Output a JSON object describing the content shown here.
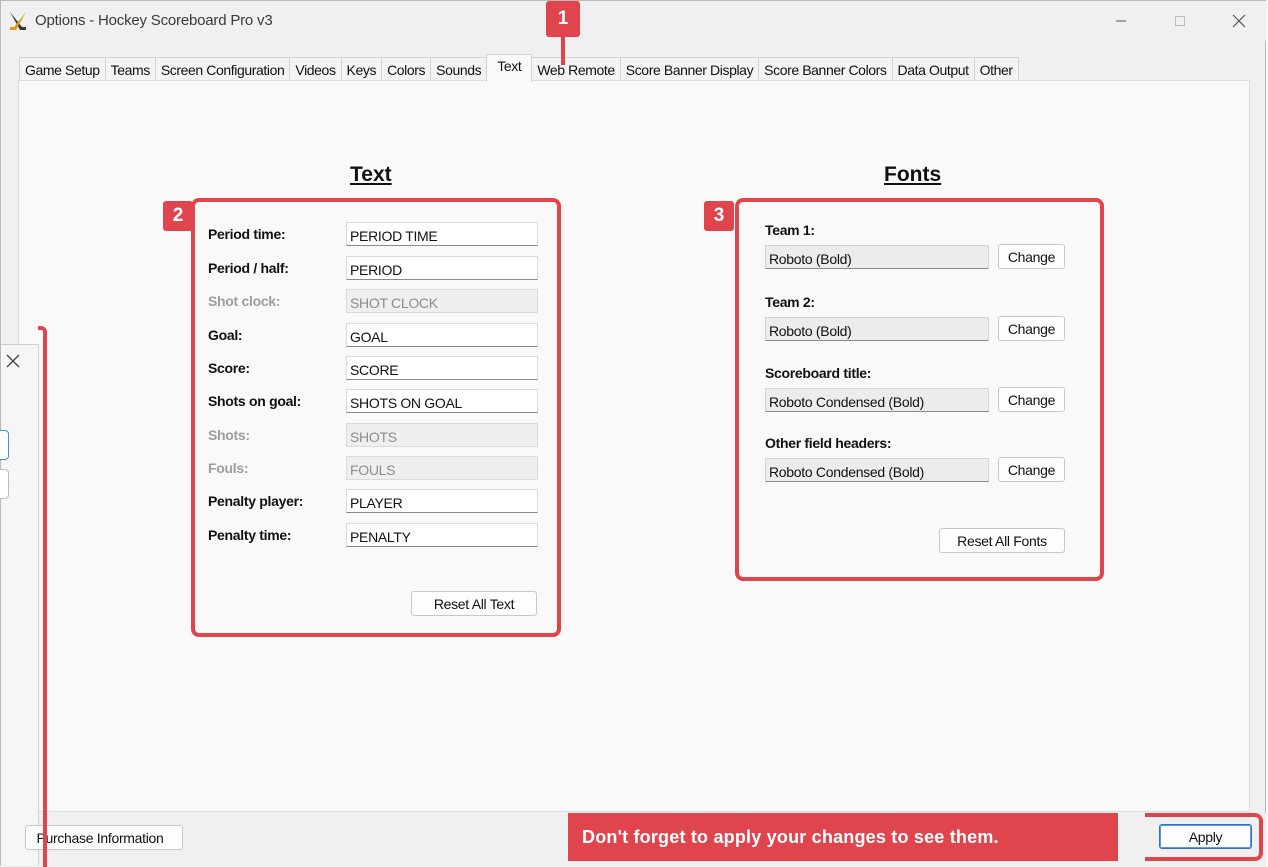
{
  "window": {
    "title": "Options - Hockey Scoreboard Pro v3",
    "controls": [
      "minimize",
      "maximize",
      "close"
    ]
  },
  "tabs": [
    {
      "label": "Game Setup"
    },
    {
      "label": "Teams"
    },
    {
      "label": "Screen Configuration"
    },
    {
      "label": "Videos"
    },
    {
      "label": "Keys"
    },
    {
      "label": "Colors"
    },
    {
      "label": "Sounds"
    },
    {
      "label": "Text",
      "active": true
    },
    {
      "label": "Web Remote"
    },
    {
      "label": "Score Banner Display"
    },
    {
      "label": "Score Banner Colors"
    },
    {
      "label": "Data Output"
    },
    {
      "label": "Other"
    }
  ],
  "text_section": {
    "heading": "Text",
    "fields": [
      {
        "label": "Period time:",
        "value": "PERIOD TIME",
        "enabled": true
      },
      {
        "label": "Period / half:",
        "value": "PERIOD",
        "enabled": true
      },
      {
        "label": "Shot clock:",
        "value": "SHOT CLOCK",
        "enabled": false
      },
      {
        "label": "Goal:",
        "value": "GOAL",
        "enabled": true
      },
      {
        "label": "Score:",
        "value": "SCORE",
        "enabled": true
      },
      {
        "label": "Shots on goal:",
        "value": "SHOTS ON GOAL",
        "enabled": true
      },
      {
        "label": "Shots:",
        "value": "SHOTS",
        "enabled": false
      },
      {
        "label": "Fouls:",
        "value": "FOULS",
        "enabled": false
      },
      {
        "label": "Penalty player:",
        "value": "PLAYER",
        "enabled": true
      },
      {
        "label": "Penalty time:",
        "value": "PENALTY",
        "enabled": true
      }
    ],
    "reset_label": "Reset All Text"
  },
  "fonts_section": {
    "heading": "Fonts",
    "fonts": [
      {
        "label": "Team 1:",
        "value": "Roboto (Bold)",
        "button": "Change"
      },
      {
        "label": "Team 2:",
        "value": "Roboto (Bold)",
        "button": "Change"
      },
      {
        "label": "Scoreboard title:",
        "value": "Roboto Condensed (Bold)",
        "button": "Change"
      },
      {
        "label": "Other field headers:",
        "value": "Roboto Condensed (Bold)",
        "button": "Change"
      }
    ],
    "reset_label": "Reset All Fonts"
  },
  "callouts": {
    "badge_1": "1",
    "badge_2": "2",
    "badge_3": "3",
    "apply_note": "Don't forget to apply your changes to see them."
  },
  "footer": {
    "purchase_label": "Purchase Information",
    "apply_label": "Apply"
  },
  "colors": {
    "accent": "#e0454e",
    "window_bg": "#f0f0f0",
    "panel_bg": "#f9f9f9"
  }
}
